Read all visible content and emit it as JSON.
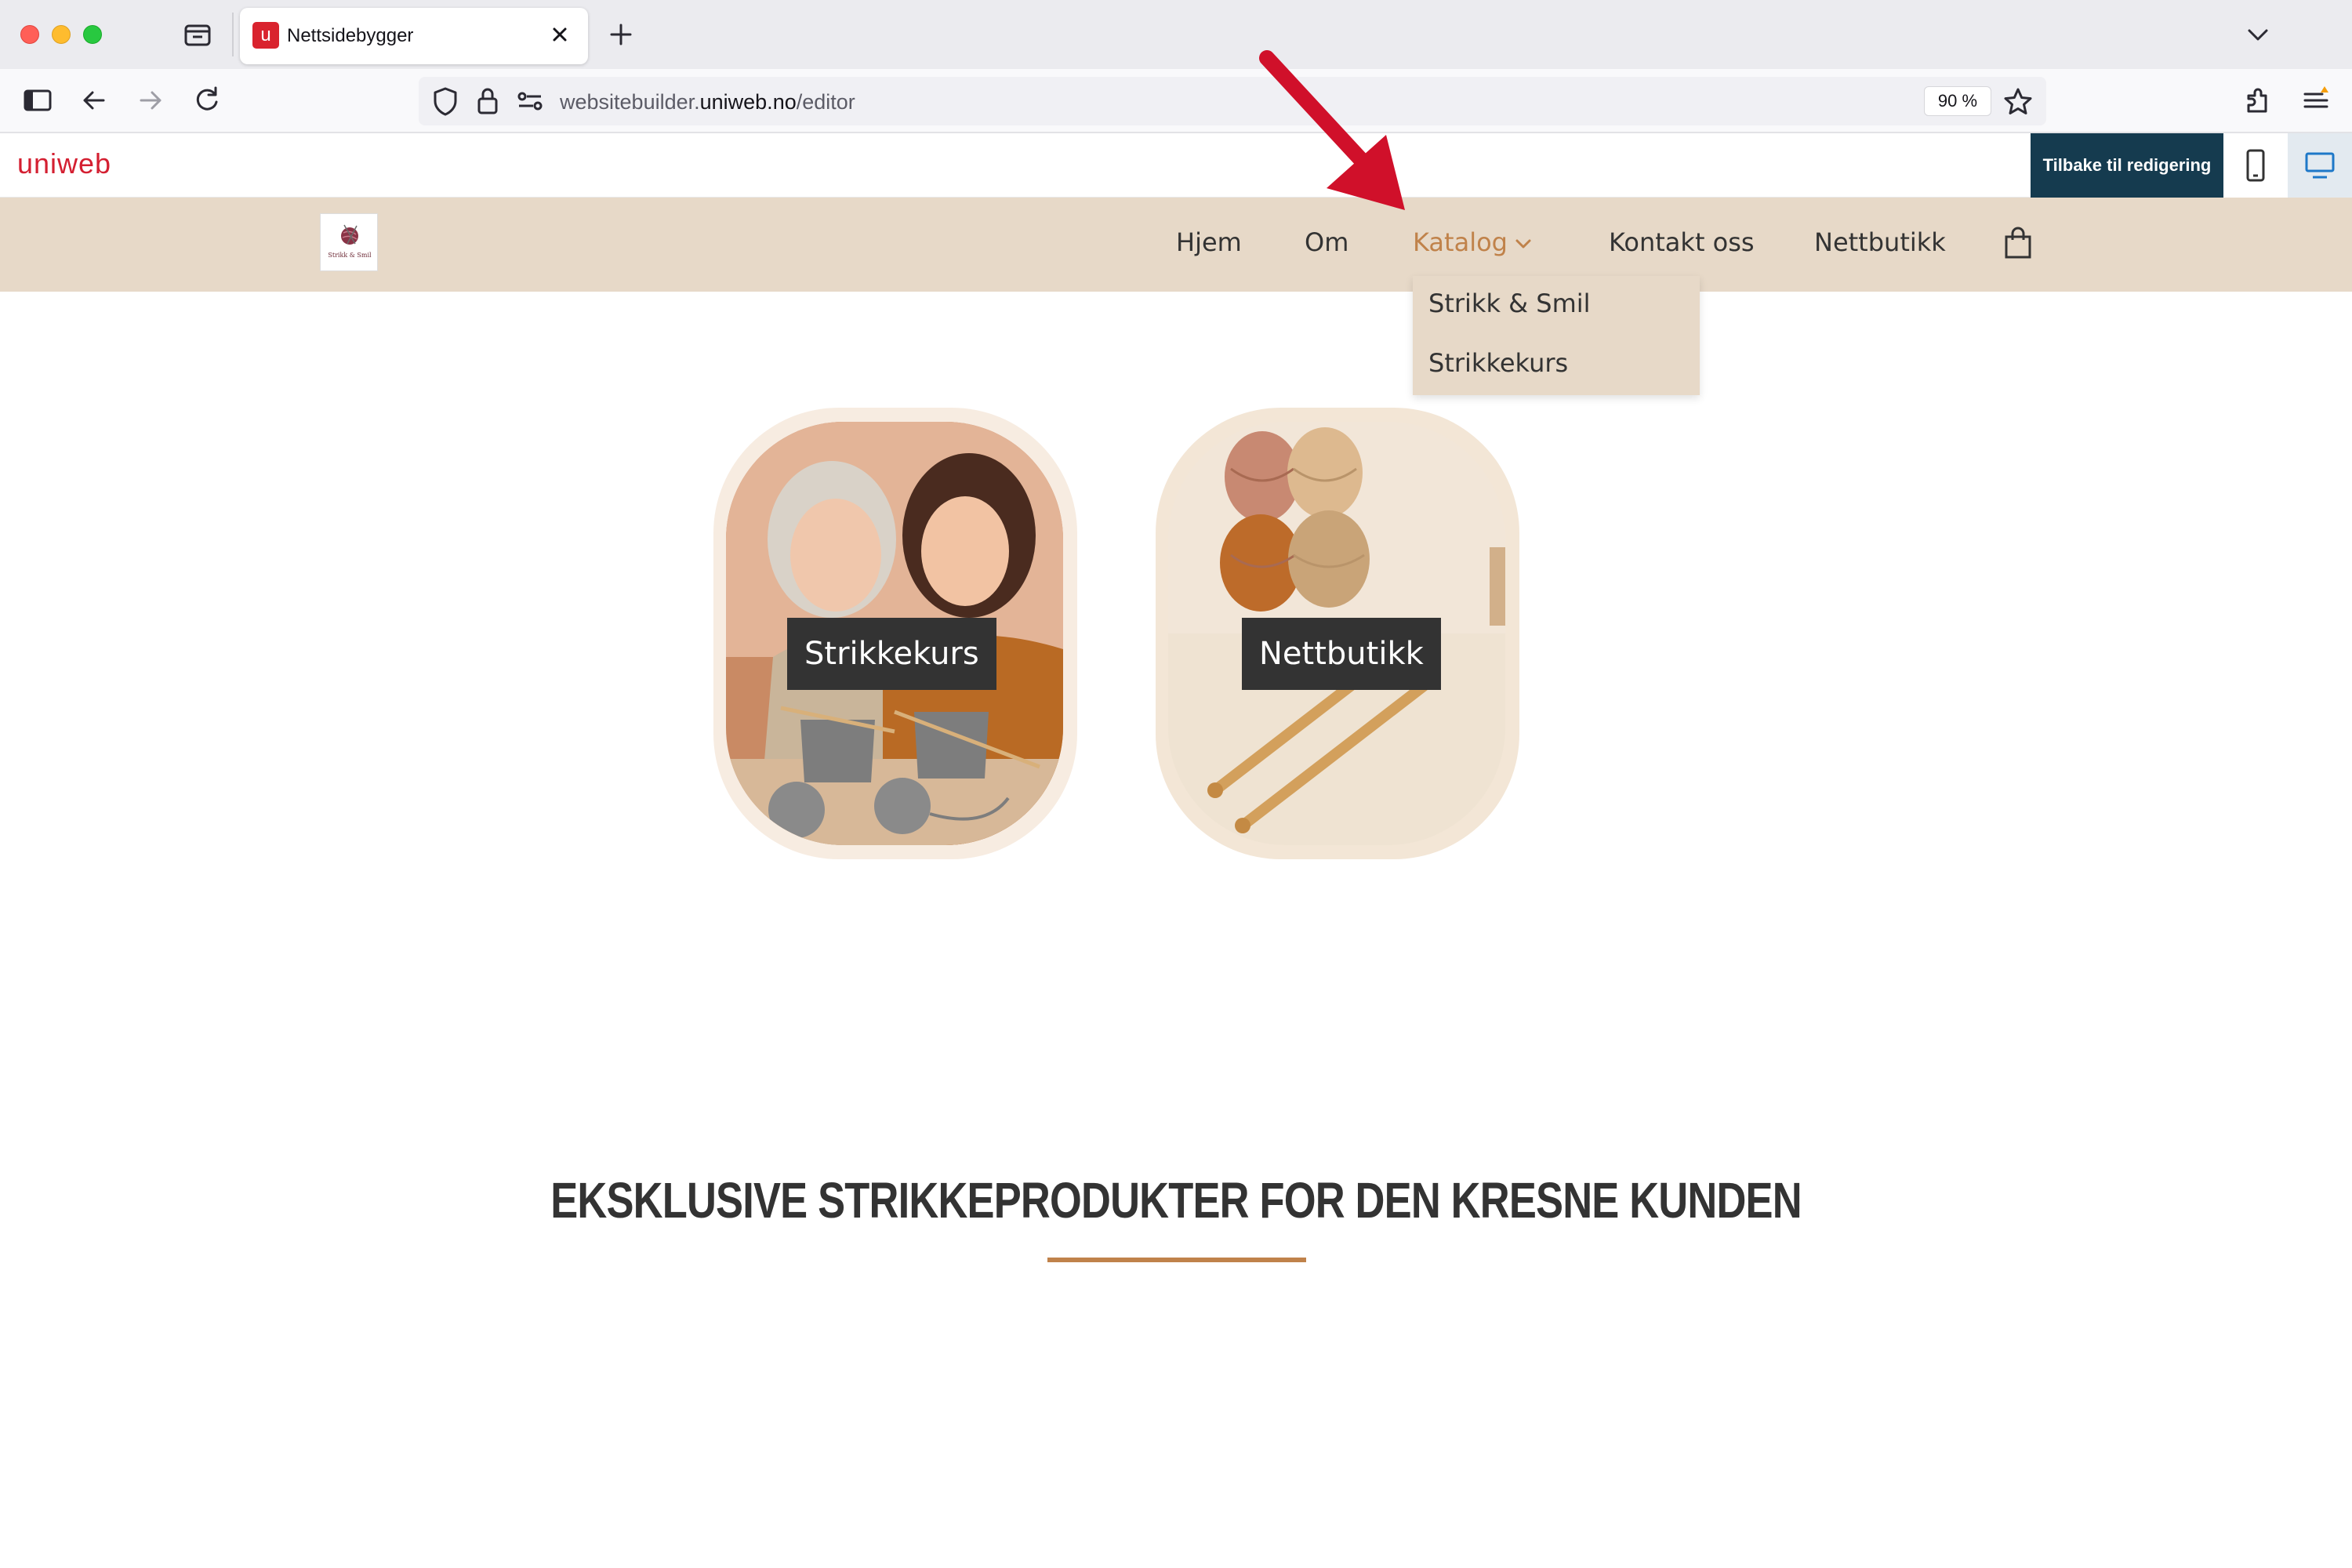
{
  "browser": {
    "tab": {
      "favicon_letter": "u",
      "title": "Nettsidebygger"
    },
    "url": {
      "prefix": "websitebuilder.",
      "host": "uniweb.no",
      "path": "/editor"
    },
    "zoom": "90 %"
  },
  "editor": {
    "logo": "uniweb",
    "back_to_edit_label": "Tilbake til redigering",
    "view_modes": [
      "mobile-icon",
      "desktop-icon"
    ],
    "active_view": "desktop"
  },
  "site": {
    "logo_text": "Strikk & Smil",
    "menu": {
      "hjem": "Hjem",
      "om": "Om",
      "katalog": "Katalog",
      "kontakt": "Kontakt oss",
      "nettbutikk": "Nettbutikk"
    },
    "dropdown": [
      "Strikk & Smil",
      "Strikkekurs"
    ],
    "cards": [
      {
        "label": "Strikkekurs"
      },
      {
        "label": "Nettbutikk"
      }
    ],
    "section_title": "EKSKLUSIVE STRIKKEPRODUKTER FOR DEN KRESNE KUNDEN"
  },
  "colors": {
    "accent": "#c0824a",
    "header_bg": "#e7d9c8",
    "brand_red": "#d41f31",
    "editor_button": "#153b4f",
    "annotation_arrow": "#d0102a"
  }
}
